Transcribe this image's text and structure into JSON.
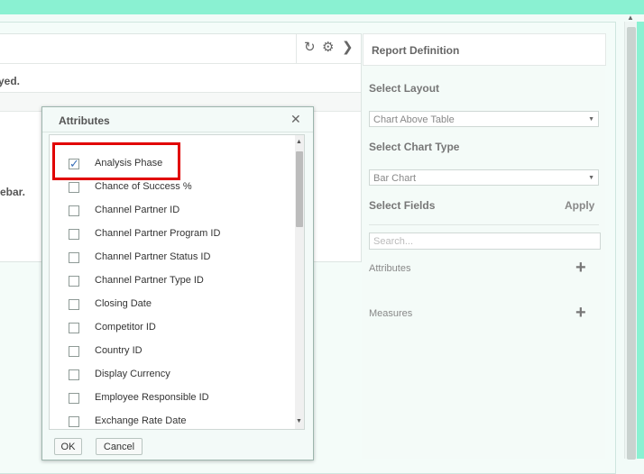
{
  "main": {
    "message_fragment": "yed.",
    "sidebar_fragment": "ebar.",
    "refresh_icon": "refresh-icon",
    "settings_icon": "gear-icon",
    "collapse_icon": "chevron-right-icon"
  },
  "report_definition": {
    "title": "Report Definition",
    "select_layout_label": "Select Layout",
    "layout_value": "Chart Above Table",
    "select_chart_type_label": "Select Chart Type",
    "chart_type_value": "Bar Chart",
    "select_fields_label": "Select Fields",
    "apply_label": "Apply",
    "search_placeholder": "Search...",
    "attributes_label": "Attributes",
    "measures_label": "Measures"
  },
  "dialog": {
    "title": "Attributes",
    "items": [
      {
        "label": "Analysis Phase",
        "checked": true
      },
      {
        "label": "Chance of Success %",
        "checked": false
      },
      {
        "label": "Channel Partner ID",
        "checked": false
      },
      {
        "label": "Channel Partner Program ID",
        "checked": false
      },
      {
        "label": "Channel Partner Status ID",
        "checked": false
      },
      {
        "label": "Channel Partner Type ID",
        "checked": false
      },
      {
        "label": "Closing Date",
        "checked": false
      },
      {
        "label": "Competitor ID",
        "checked": false
      },
      {
        "label": "Country ID",
        "checked": false
      },
      {
        "label": "Display Currency",
        "checked": false
      },
      {
        "label": "Employee Responsible ID",
        "checked": false
      },
      {
        "label": "Exchange Rate Date",
        "checked": false
      }
    ],
    "ok_label": "OK",
    "cancel_label": "Cancel"
  },
  "colors": {
    "accent_top": "#8af1d2",
    "highlight": "#e10000"
  }
}
